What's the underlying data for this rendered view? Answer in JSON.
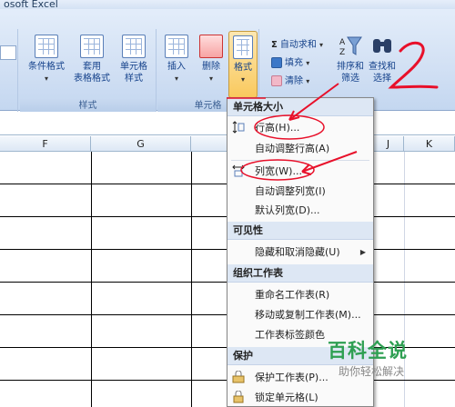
{
  "window": {
    "title": "osoft Excel"
  },
  "ribbon": {
    "styles_group": {
      "caption": "样式",
      "conditional_format": "条件格式",
      "table_format_line1": "套用",
      "table_format_line2": "表格格式",
      "cell_styles_line1": "单元格",
      "cell_styles_line2": "样式"
    },
    "cells_group": {
      "caption": "单元格",
      "insert": "插入",
      "delete": "删除",
      "format": "格式"
    },
    "editing_group": {
      "autosum": "自动求和",
      "fill": "填充",
      "clear": "清除",
      "sort_line1": "排序和",
      "sort_line2": "筛选",
      "find_line1": "查找和",
      "find_line2": "选择"
    }
  },
  "columns": [
    "F",
    "G",
    "J",
    "K"
  ],
  "menu": {
    "section_cell_size": "单元格大小",
    "row_height": "行高(H)...",
    "autofit_row_height": "自动调整行高(A)",
    "column_width": "列宽(W)...",
    "autofit_column_width": "自动调整列宽(I)",
    "default_width": "默认列宽(D)...",
    "section_visibility": "可见性",
    "hide_unhide": "隐藏和取消隐藏(U)",
    "section_organize": "组织工作表",
    "rename_sheet": "重命名工作表(R)",
    "move_copy_sheet": "移动或复制工作表(M)...",
    "tab_color": "工作表标签颜色",
    "section_protection": "保护",
    "protect_sheet": "保护工作表(P)...",
    "lock_cell": "锁定单元格(L)"
  },
  "watermark": {
    "title": "百科全说",
    "subtitle": "助你轻松解决"
  },
  "colors": {
    "annotation_red": "#e8102a",
    "ribbon_blue": "#15428b"
  }
}
